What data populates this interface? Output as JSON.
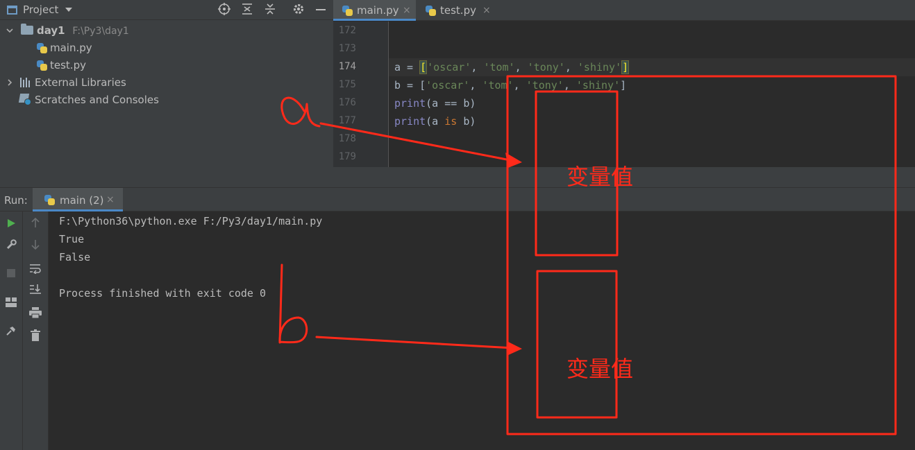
{
  "project_panel": {
    "title": "Project",
    "tree": [
      {
        "name": "day1",
        "path": "F:\\Py3\\day1"
      },
      {
        "name": "main.py"
      },
      {
        "name": "test.py"
      },
      {
        "name": "External Libraries"
      },
      {
        "name": "Scratches and Consoles"
      }
    ]
  },
  "editor": {
    "tabs": [
      {
        "label": "main.py",
        "close": "×"
      },
      {
        "label": "test.py",
        "close": "×"
      }
    ],
    "line_numbers": [
      "172",
      "173",
      "174",
      "175",
      "176",
      "177",
      "178",
      "179"
    ],
    "code": {
      "l174": {
        "var": "a = ",
        "open": "[",
        "s1": "'oscar'",
        "c1": ", ",
        "s2": "'tom'",
        "c2": ", ",
        "s3": "'tony'",
        "c3": ", ",
        "s4": "'shiny'",
        "close": "]"
      },
      "l175": {
        "var": "b = [",
        "s1": "'oscar'",
        "c1": ", ",
        "s2": "'tom'",
        "c2": ", ",
        "s3": "'tony'",
        "c3": ", ",
        "s4": "'shiny'",
        "close": "]"
      },
      "l176": {
        "fn": "print",
        "rest": "(a == b)"
      },
      "l177": {
        "fn": "print",
        "open": "(a ",
        "kw": "is",
        "rest": " b)"
      }
    }
  },
  "run_panel": {
    "label": "Run:",
    "tab_label": "main (2)",
    "tab_close": "×",
    "output": [
      "F:\\Python36\\python.exe F:/Py3/day1/main.py",
      "True",
      "False",
      "",
      "Process finished with exit code 0"
    ]
  },
  "annotations": {
    "label_a": "a",
    "label_b": "b",
    "box_text_1": "变量值",
    "box_text_2": "变量值",
    "color": "#ff2a1a"
  },
  "icons": [
    "project-icon",
    "target-icon",
    "expand-all-icon",
    "collapse-all-icon",
    "gear-icon",
    "minimize-icon",
    "run-icon",
    "wrench-icon",
    "stop-icon",
    "layout-icon",
    "pin-icon",
    "up-arrow-icon",
    "down-arrow-icon",
    "soft-wrap-icon",
    "scroll-to-end-icon",
    "print-icon",
    "trash-icon"
  ]
}
